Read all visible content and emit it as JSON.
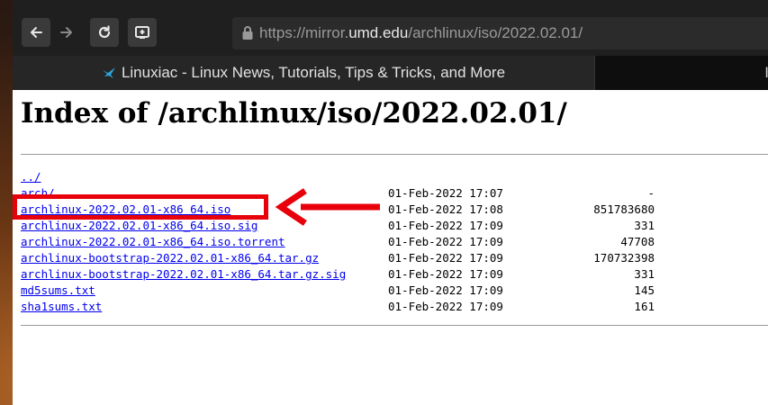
{
  "browser": {
    "url": {
      "prefix": "https://mirror.",
      "host": "umd.edu",
      "path": "/archlinux/iso/2022.02.01/"
    },
    "tabs": [
      {
        "title": "Linuxiac - Linux News, Tutorials, Tips & Tricks, and More",
        "active": true
      },
      {
        "title": "I",
        "active": false
      }
    ],
    "icons": [
      "back-arrow-icon",
      "forward-arrow-icon",
      "reload-icon",
      "screenshot-icon",
      "lock-icon",
      "bird-favicon-icon"
    ]
  },
  "page": {
    "title": "Index of /archlinux/iso/2022.02.01/",
    "entries": [
      {
        "name": "../",
        "date": "",
        "size": ""
      },
      {
        "name": "arch/",
        "date": "01-Feb-2022 17:07",
        "size": "-"
      },
      {
        "name": "archlinux-2022.02.01-x86_64.iso",
        "date": "01-Feb-2022 17:08",
        "size": "851783680"
      },
      {
        "name": "archlinux-2022.02.01-x86_64.iso.sig",
        "date": "01-Feb-2022 17:09",
        "size": "331"
      },
      {
        "name": "archlinux-2022.02.01-x86_64.iso.torrent",
        "date": "01-Feb-2022 17:09",
        "size": "47708"
      },
      {
        "name": "archlinux-bootstrap-2022.02.01-x86_64.tar.gz",
        "date": "01-Feb-2022 17:09",
        "size": "170732398"
      },
      {
        "name": "archlinux-bootstrap-2022.02.01-x86_64.tar.gz.sig",
        "date": "01-Feb-2022 17:09",
        "size": "331"
      },
      {
        "name": "md5sums.txt",
        "date": "01-Feb-2022 17:09",
        "size": "145"
      },
      {
        "name": "sha1sums.txt",
        "date": "01-Feb-2022 17:09",
        "size": "161"
      }
    ]
  },
  "colors": {
    "link": "#0000ee",
    "highlight": "#e8000a",
    "toolbar": "#1f1f1f"
  }
}
